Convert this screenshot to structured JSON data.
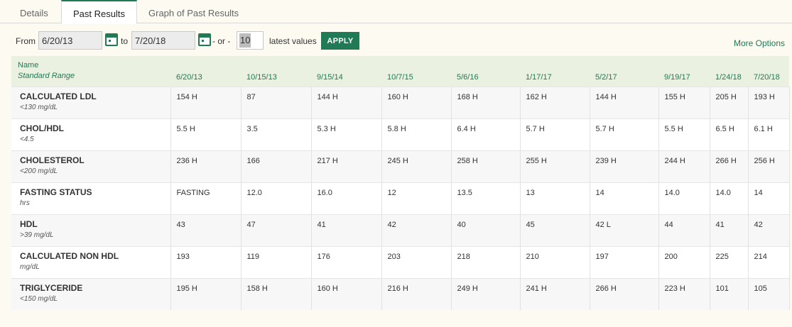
{
  "tabs": [
    {
      "label": "Details",
      "active": false
    },
    {
      "label": "Past Results",
      "active": true
    },
    {
      "label": "Graph of Past Results",
      "active": false
    }
  ],
  "filter": {
    "from_label": "From",
    "from_value": "6/20/13",
    "to_label": "to",
    "to_value": "7/20/18",
    "or_label": "- or -",
    "count_value": "10",
    "latest_label": "latest values",
    "apply_label": "APPLY",
    "more_options": "More Options"
  },
  "table": {
    "header_name": "Name",
    "header_range": "Standard Range",
    "dates": [
      "6/20/13",
      "10/15/13",
      "9/15/14",
      "10/7/15",
      "5/6/16",
      "1/17/17",
      "5/2/17",
      "9/19/17",
      "1/24/18",
      "7/20/18"
    ],
    "rows": [
      {
        "name": "CALCULATED LDL",
        "range": "<130 mg/dL",
        "values": [
          "154 H",
          "87",
          "144 H",
          "160 H",
          "168 H",
          "162 H",
          "144 H",
          "155 H",
          "205 H",
          "193 H"
        ]
      },
      {
        "name": "CHOL/HDL",
        "range": "<4.5",
        "values": [
          "5.5 H",
          "3.5",
          "5.3 H",
          "5.8 H",
          "6.4 H",
          "5.7 H",
          "5.7 H",
          "5.5 H",
          "6.5 H",
          "6.1 H"
        ]
      },
      {
        "name": "CHOLESTEROL",
        "range": "<200 mg/dL",
        "values": [
          "236 H",
          "166",
          "217 H",
          "245 H",
          "258 H",
          "255 H",
          "239 H",
          "244 H",
          "266 H",
          "256 H"
        ]
      },
      {
        "name": "FASTING STATUS",
        "range": "hrs",
        "values": [
          "FASTING",
          "12.0",
          "16.0",
          "12",
          "13.5",
          "13",
          "14",
          "14.0",
          "14.0",
          "14"
        ]
      },
      {
        "name": "HDL",
        "range": ">39 mg/dL",
        "values": [
          "43",
          "47",
          "41",
          "42",
          "40",
          "45",
          "42 L",
          "44",
          "41",
          "42"
        ]
      },
      {
        "name": "CALCULATED NON HDL",
        "range": "mg/dL",
        "values": [
          "193",
          "119",
          "176",
          "203",
          "218",
          "210",
          "197",
          "200",
          "225",
          "214"
        ]
      },
      {
        "name": "TRIGLYCERIDE",
        "range": "<150 mg/dL",
        "values": [
          "195 H",
          "158 H",
          "160 H",
          "216 H",
          "249 H",
          "241 H",
          "266 H",
          "223 H",
          "101",
          "105"
        ]
      }
    ]
  },
  "colors": {
    "accent": "#1f7a55",
    "header_bg": "#eaf1e0",
    "page_bg": "#fdfaf1"
  }
}
